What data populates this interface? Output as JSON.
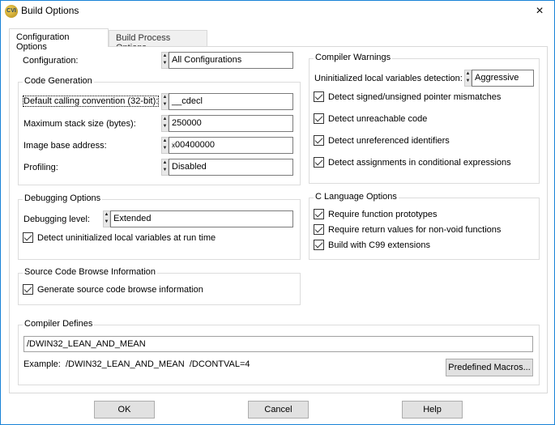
{
  "window": {
    "title": "Build Options",
    "close_icon": "×",
    "app_icon_text": "CVI"
  },
  "tabs": [
    {
      "label": "Configuration Options",
      "selected": true
    },
    {
      "label": "Build Process Options",
      "selected": false
    }
  ],
  "configuration": {
    "label": "Configuration:",
    "value": "All Configurations"
  },
  "code_generation": {
    "title": "Code Generation",
    "rows": [
      {
        "label": "Default calling convention (32-bit):",
        "value": "__cdecl"
      },
      {
        "label": "Maximum stack size (bytes):",
        "value": "250000"
      },
      {
        "label": "Image base address:",
        "prefix": "x",
        "value": "00400000"
      },
      {
        "label": "Profiling:",
        "value": "Disabled"
      }
    ]
  },
  "debugging": {
    "title": "Debugging Options",
    "level_label": "Debugging level:",
    "level_value": "Extended",
    "detect_label": "Detect uninitialized local variables at run time",
    "detect_checked": true
  },
  "browse": {
    "title": "Source Code Browse Information",
    "generate_label": "Generate source code browse information",
    "generate_checked": true
  },
  "warnings": {
    "title": "Compiler Warnings",
    "uninit_label": "Uninitialized local variables detection:",
    "uninit_value": "Aggressive",
    "checks": [
      {
        "label": "Detect signed/unsigned pointer mismatches",
        "checked": true
      },
      {
        "label": "Detect unreachable code",
        "checked": true
      },
      {
        "label": "Detect unreferenced identifiers",
        "checked": true
      },
      {
        "label": "Detect assignments in conditional expressions",
        "checked": true
      }
    ]
  },
  "c_language": {
    "title": "C Language Options",
    "checks": [
      {
        "label": "Require function prototypes",
        "checked": true
      },
      {
        "label": "Require return values for non-void functions",
        "checked": true
      },
      {
        "label": "Build with C99 extensions",
        "checked": true
      }
    ]
  },
  "defines": {
    "title": "Compiler Defines",
    "value": "/DWIN32_LEAN_AND_MEAN",
    "example_label": "Example:",
    "example_value": "/DWIN32_LEAN_AND_MEAN  /DCONTVAL=4",
    "macros_button": "Predefined Macros..."
  },
  "buttons": {
    "ok": "OK",
    "cancel": "Cancel",
    "help": "Help"
  },
  "colors": {
    "window_border": "#1883d7",
    "button_bg": "#e1e1e1"
  }
}
